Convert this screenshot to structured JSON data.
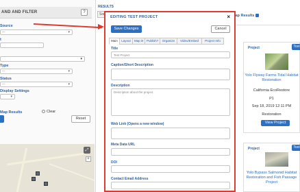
{
  "left_panel": {
    "title": "AND AND FILTER",
    "help": "?",
    "labels": {
      "source": "Source",
      "t": "t",
      "type": "Type",
      "status": "Status",
      "display": "Display Settings"
    },
    "select_placeholder": "---",
    "map_results": "Map Results",
    "clear": "Clear",
    "reset": "Reset"
  },
  "results": {
    "label": "RESULTS",
    "sort": "Sor",
    "map_results": "Map Results"
  },
  "modal": {
    "title": "EDITING TEST PROJECT",
    "close": "×",
    "save": "Save Changes",
    "cancel": "Cancel",
    "tabs": [
      "Main",
      "Layout",
      "Map it!",
      "Publish?",
      "Organize",
      "Video/Embed",
      "Project Info"
    ],
    "active_tab": "Main",
    "fields": {
      "title_label": "Title",
      "title_value": "Test Project",
      "caption_label": "Caption/Short Description",
      "description_label": "Description",
      "description_placeholder": "Description about the project.",
      "weblink_label": "Web Link (Opens a new window)",
      "metadata_label": "Meta Data URL",
      "doi_label": "DOI",
      "contact_label": "Contact Email Address"
    }
  },
  "cards": [
    {
      "type": "Project",
      "button": "Tool",
      "link_line1": "Yolo Flyway Farms Tidal Habitat",
      "link_line2": "Restoration",
      "org": "California EcoRestore",
      "id": "P1",
      "date": "Sep 18, 2019 12:11 PM",
      "category": "Restoration",
      "view": "View Project"
    },
    {
      "type": "Project",
      "button": "Tool",
      "link_line1": "Yolo Bypass Salmonid Habitat",
      "link_line2": "Restoration and Fish Passage",
      "link_line3": "Project"
    }
  ],
  "colors": {
    "accent_blue": "#2d6fc1",
    "annotation_red": "#e03a2f",
    "label_blue": "#2d5fa3"
  }
}
